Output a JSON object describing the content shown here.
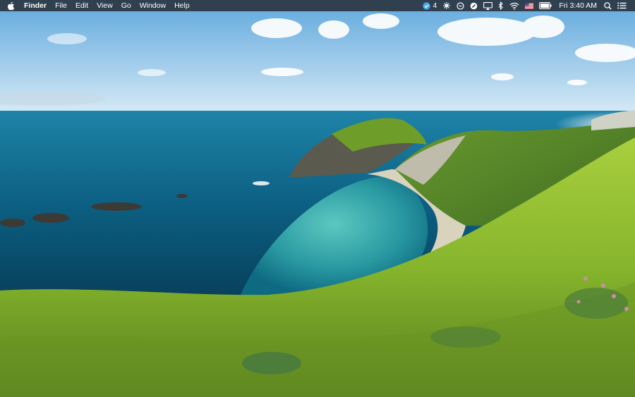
{
  "menubar": {
    "app_name": "Finder",
    "menus": [
      "File",
      "Edit",
      "View",
      "Go",
      "Window",
      "Help"
    ],
    "status": {
      "notification_count": "4",
      "clock": "Fri 3:40 AM"
    },
    "icons": [
      "apple-logo-icon",
      "app-badge-icon",
      "bluetooth-grid-icon",
      "sync-icon",
      "dnd-icon",
      "airplay-icon",
      "bluetooth-icon",
      "wifi-icon",
      "us-flag-input-icon",
      "battery-icon",
      "spotlight-search-icon",
      "notification-center-icon"
    ]
  },
  "desktop": {
    "wallpaper": "coastal-cove-landscape",
    "colors": {
      "sky": "#8fc3e6",
      "sea": "#0b5c7a",
      "lagoon": "#3fb7b1",
      "grass": "#8cbd2f"
    }
  }
}
